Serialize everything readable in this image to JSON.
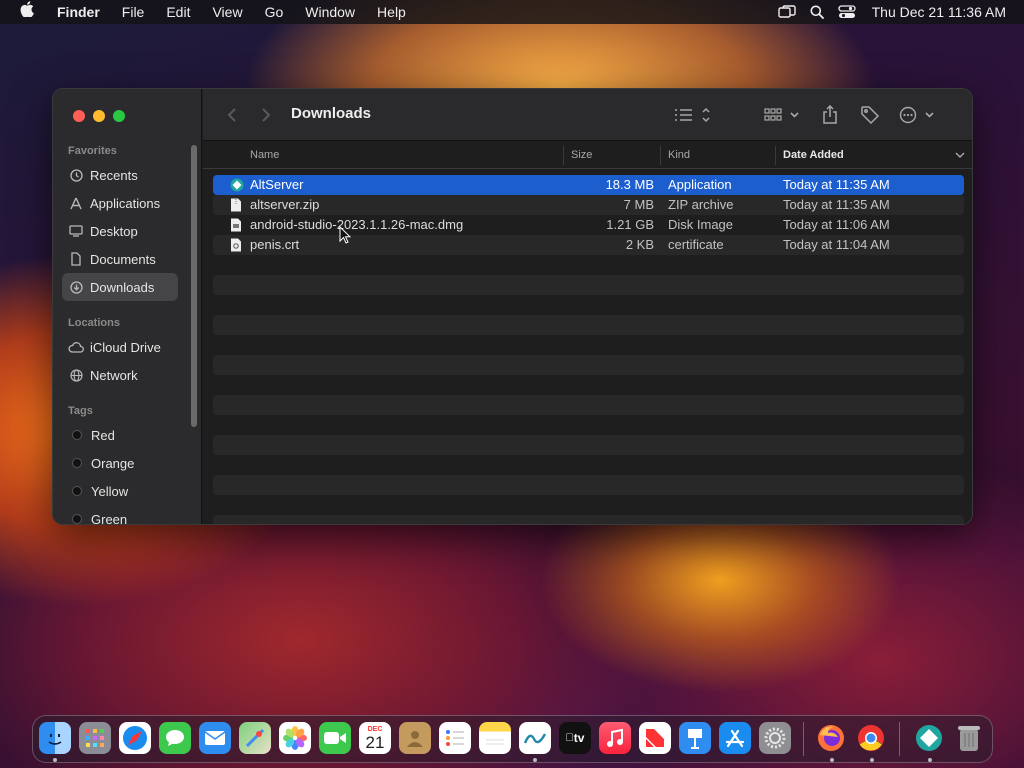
{
  "menubar": {
    "apple_icon": "apple-icon",
    "app_name": "Finder",
    "items": [
      "File",
      "Edit",
      "View",
      "Go",
      "Window",
      "Help"
    ],
    "clock": "Thu Dec 21  11:36 AM"
  },
  "finder": {
    "title": "Downloads",
    "sidebar": {
      "favorites_heading": "Favorites",
      "favorites": [
        {
          "label": "Recents",
          "icon": "clock-icon"
        },
        {
          "label": "Applications",
          "icon": "applications-icon"
        },
        {
          "label": "Desktop",
          "icon": "desktop-icon"
        },
        {
          "label": "Documents",
          "icon": "document-icon"
        },
        {
          "label": "Downloads",
          "icon": "download-icon",
          "selected": true
        }
      ],
      "locations_heading": "Locations",
      "locations": [
        {
          "label": "iCloud Drive",
          "icon": "cloud-icon"
        },
        {
          "label": "Network",
          "icon": "globe-icon"
        }
      ],
      "tags_heading": "Tags",
      "tags": [
        "Red",
        "Orange",
        "Yellow",
        "Green"
      ]
    },
    "columns": {
      "name": "Name",
      "size": "Size",
      "kind": "Kind",
      "date": "Date Added"
    },
    "files": [
      {
        "name": "AltServer",
        "size": "18.3 MB",
        "kind": "Application",
        "date": "Today at 11:35 AM",
        "selected": true
      },
      {
        "name": "altserver.zip",
        "size": "7 MB",
        "kind": "ZIP archive",
        "date": "Today at 11:35 AM"
      },
      {
        "name": "android-studio-2023.1.1.26-mac.dmg",
        "size": "1.21 GB",
        "kind": "Disk Image",
        "date": "Today at 11:06 AM"
      },
      {
        "name": "penis.crt",
        "size": "2 KB",
        "kind": "certificate",
        "date": "Today at 11:04 AM"
      }
    ],
    "selection_color": "#1d5ecf"
  },
  "dock": {
    "apps": [
      "Finder",
      "Launchpad",
      "Safari",
      "Messages",
      "Mail",
      "Maps",
      "Photos",
      "FaceTime",
      "Calendar",
      "Contacts",
      "Reminders",
      "Notes",
      "Freeform",
      "TV",
      "Music",
      "News",
      "Keynote",
      "App Store",
      "System Settings",
      "Firefox",
      "Chrome",
      "AltServer",
      "Trash"
    ],
    "calendar_month": "DEC",
    "calendar_day": "21",
    "tv_label": "tv"
  }
}
